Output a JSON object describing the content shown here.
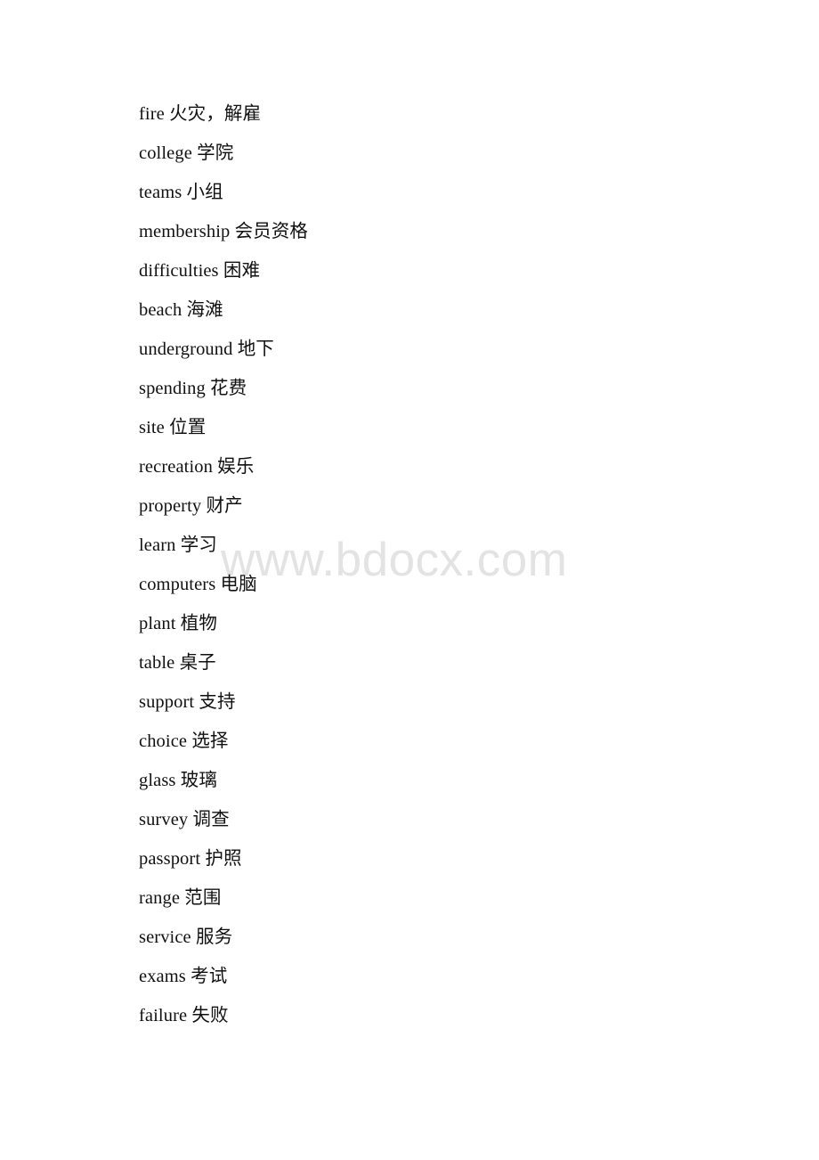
{
  "document": {
    "type": "vocabulary-list",
    "background_color": "#ffffff",
    "text_color": "#111111"
  },
  "watermark": {
    "text": "www.bdocx.com",
    "color": "#e3e3e3"
  },
  "vocabulary": {
    "entries": [
      {
        "term": "fire 火灾，解雇"
      },
      {
        "term": "college 学院"
      },
      {
        "term": "teams 小组"
      },
      {
        "term": "membership 会员资格"
      },
      {
        "term": "difficulties 困难"
      },
      {
        "term": "beach 海滩"
      },
      {
        "term": "underground 地下"
      },
      {
        "term": "spending 花费"
      },
      {
        "term": "site 位置"
      },
      {
        "term": "recreation 娱乐"
      },
      {
        "term": "property 财产"
      },
      {
        "term": "learn 学习"
      },
      {
        "term": "computers 电脑"
      },
      {
        "term": "plant 植物"
      },
      {
        "term": "table 桌子"
      },
      {
        "term": "support 支持"
      },
      {
        "term": "choice 选择"
      },
      {
        "term": "glass 玻璃"
      },
      {
        "term": "survey 调查"
      },
      {
        "term": "passport 护照"
      },
      {
        "term": "range 范围"
      },
      {
        "term": "service 服务"
      },
      {
        "term": "exams 考试"
      },
      {
        "term": "failure 失败"
      }
    ]
  }
}
